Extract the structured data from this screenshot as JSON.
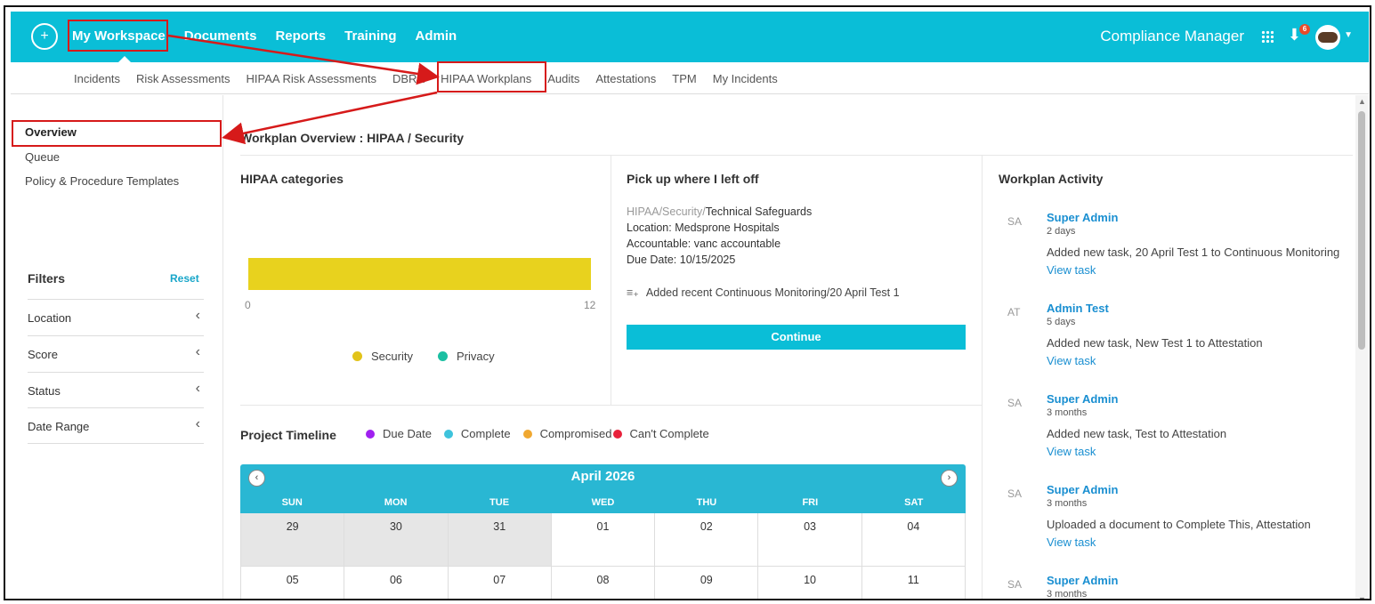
{
  "topnav": {
    "items": [
      "My Workspace",
      "Documents",
      "Reports",
      "Training",
      "Admin"
    ],
    "app_name": "Compliance Manager",
    "download_badge": "6",
    "icons": [
      "logo-icon",
      "grid-icon",
      "download-icon",
      "avatar",
      "chevron-down-icon"
    ]
  },
  "subnav": {
    "items": [
      "Incidents",
      "Risk Assessments",
      "HIPAA Risk Assessments",
      "DBRA",
      "HIPAA Workplans",
      "Audits",
      "Attestations",
      "TPM",
      "My Incidents"
    ]
  },
  "sidebar": {
    "links": [
      "Overview",
      "Queue",
      "Policy & Procedure Templates"
    ],
    "filters_title": "Filters",
    "reset": "Reset",
    "filters": [
      "Location",
      "Score",
      "Status",
      "Date Range"
    ]
  },
  "main": {
    "title": "Workplan Overview : HIPAA / Security"
  },
  "categories": {
    "title": "HIPAA categories",
    "axis_min": "0",
    "axis_max": "12",
    "legend": [
      {
        "label": "Security",
        "color": "#e2c31a"
      },
      {
        "label": "Privacy",
        "color": "#1bbfa2"
      }
    ]
  },
  "chart_data": {
    "type": "bar",
    "categories": [
      "Security"
    ],
    "values": [
      12
    ],
    "xlim": [
      0,
      12
    ]
  },
  "pickup": {
    "title": "Pick up where I left off",
    "path_muted": "HIPAA/Security/",
    "path_current": "Technical Safeguards",
    "location": "Location: Medsprone Hospitals",
    "accountable": "Accountable: vanc accountable",
    "due": "Due Date: 10/15/2025",
    "recent": "Added recent Continuous Monitoring/20 April Test 1",
    "continue": "Continue"
  },
  "timeline": {
    "title": "Project Timeline",
    "legend": [
      {
        "label": "Due Date",
        "color": "#a020f0"
      },
      {
        "label": "Complete",
        "color": "#3ec3dc"
      },
      {
        "label": "Compromised",
        "color": "#f0a830"
      },
      {
        "label": "Can't Complete",
        "color": "#e8213b"
      }
    ],
    "month": "April 2026",
    "days": [
      "SUN",
      "MON",
      "TUE",
      "WED",
      "THU",
      "FRI",
      "SAT"
    ],
    "weeks": [
      [
        "29",
        "30",
        "31",
        "01",
        "02",
        "03",
        "04"
      ],
      [
        "05",
        "06",
        "07",
        "08",
        "09",
        "10",
        "11"
      ]
    ]
  },
  "activity": {
    "title": "Workplan Activity",
    "items": [
      {
        "initials": "SA",
        "name": "Super Admin",
        "time": "2 days",
        "desc": "Added new task, 20 April Test 1 to Continuous Monitoring",
        "link": "View task"
      },
      {
        "initials": "AT",
        "name": "Admin Test",
        "time": "5 days",
        "desc": "Added new task, New Test 1 to Attestation",
        "link": "View task"
      },
      {
        "initials": "SA",
        "name": "Super Admin",
        "time": "3 months",
        "desc": "Added new task, Test to Attestation",
        "link": "View task"
      },
      {
        "initials": "SA",
        "name": "Super Admin",
        "time": "3 months",
        "desc": "Uploaded a document to Complete This, Attestation",
        "link": "View task"
      },
      {
        "initials": "SA",
        "name": "Super Admin",
        "time": "3 months",
        "desc": "",
        "link": ""
      }
    ]
  },
  "colors": {
    "brand": "#0abed7",
    "annotation": "#d61a1a",
    "link": "#1a8fd1"
  }
}
